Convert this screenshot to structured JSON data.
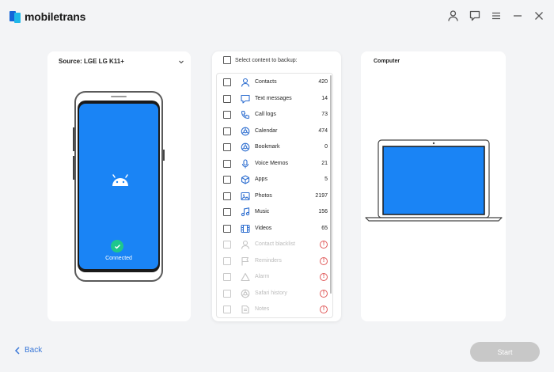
{
  "app": {
    "title": "mobiletrans"
  },
  "header": {
    "icons": [
      "user-icon",
      "feedback-icon",
      "menu-icon",
      "minimize-icon",
      "close-icon"
    ]
  },
  "source": {
    "title": "Source: LGE LG K11+",
    "status": "Connected"
  },
  "content": {
    "select_all_label": "Select content to backup:",
    "items": [
      {
        "label": "Contacts",
        "count": "420",
        "icon": "contacts-icon",
        "enabled": true
      },
      {
        "label": "Text messages",
        "count": "14",
        "icon": "message-icon",
        "enabled": true
      },
      {
        "label": "Call logs",
        "count": "73",
        "icon": "phone-icon",
        "enabled": true
      },
      {
        "label": "Calendar",
        "count": "474",
        "icon": "calendar-icon",
        "enabled": true
      },
      {
        "label": "Bookmark",
        "count": "0",
        "icon": "bookmark-icon",
        "enabled": true
      },
      {
        "label": "Voice Memos",
        "count": "21",
        "icon": "microphone-icon",
        "enabled": true
      },
      {
        "label": "Apps",
        "count": "5",
        "icon": "apps-icon",
        "enabled": true
      },
      {
        "label": "Photos",
        "count": "2197",
        "icon": "photo-icon",
        "enabled": true
      },
      {
        "label": "Music",
        "count": "156",
        "icon": "music-icon",
        "enabled": true
      },
      {
        "label": "Videos",
        "count": "65",
        "icon": "video-icon",
        "enabled": true
      },
      {
        "label": "Contact blacklist",
        "icon": "contact-blacklist-icon",
        "enabled": false
      },
      {
        "label": "Reminders",
        "icon": "flag-icon",
        "enabled": false
      },
      {
        "label": "Alarm",
        "icon": "alarm-icon",
        "enabled": false
      },
      {
        "label": "Safari history",
        "icon": "safari-icon",
        "enabled": false
      },
      {
        "label": "Notes",
        "icon": "notes-icon",
        "enabled": false
      }
    ]
  },
  "destination": {
    "title": "Computer"
  },
  "footer": {
    "back_label": "Back",
    "start_label": "Start"
  },
  "colors": {
    "accent": "#3b78d8",
    "screen_blue": "#1a84f5",
    "connected_green": "#1ec78d",
    "warning_red": "#e05a5a",
    "start_disabled": "#c8c8c8"
  }
}
